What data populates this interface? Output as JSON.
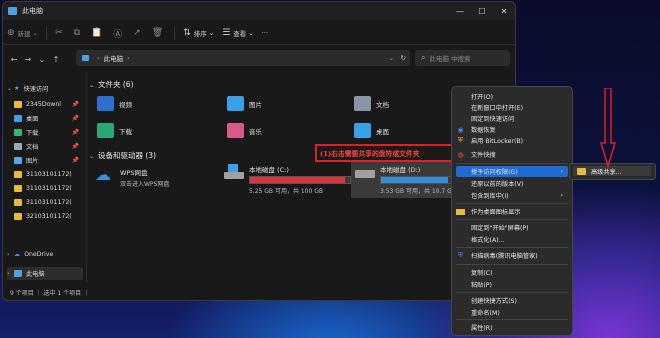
{
  "window": {
    "title": "此电脑",
    "controls": {
      "minimize": "—",
      "maximize": "☐",
      "close": "✕"
    }
  },
  "toolbar": {
    "new_label": "新建",
    "sort_label": "排序",
    "view_label": "查看",
    "more_label": "···"
  },
  "address": {
    "path": "此电脑",
    "search_placeholder": "此电脑 中搜索"
  },
  "sidebar": {
    "quick_access": "快速访问",
    "items": [
      {
        "label": "2345Downl"
      },
      {
        "label": "桌面"
      },
      {
        "label": "下载"
      },
      {
        "label": "文档"
      },
      {
        "label": "图片"
      },
      {
        "label": "31103101172("
      },
      {
        "label": "31103101172("
      },
      {
        "label": "31103101172("
      },
      {
        "label": "32103101172("
      }
    ],
    "onedrive": "OneDrive",
    "this_pc": "此电脑"
  },
  "main": {
    "folders_header": "文件夹 (6)",
    "folders": [
      "视频",
      "图片",
      "文档",
      "下载",
      "音乐",
      "桌面"
    ],
    "devices_header": "设备和驱动器 (3)",
    "drives": [
      {
        "name": "WPS网盘",
        "sub": "双击进入WPS网盘"
      },
      {
        "name": "本地磁盘 (C:)",
        "sub": "5.25 GB 可用，共 100 GB",
        "used": 0.95
      },
      {
        "name": "本地磁盘 (D:)",
        "sub": "3.53 GB 可用，共 10.7 GB",
        "used": 0.67
      }
    ]
  },
  "status": {
    "text": "9 个项目 ｜ 选中 1 个项目 ｜"
  },
  "annotation": {
    "text": "(1)右击需要共享的盘符或文件夹"
  },
  "context_menu": {
    "items": [
      "打开(O)",
      "在新窗口中打开(E)",
      "固定到快速访问",
      "数据恢复",
      "启用 BitLocker(B)",
      "文件快搜",
      "授予访问权限(G)",
      "还原以前的版本(V)",
      "包含到库中(I)",
      "作为桌面图标显示",
      "固定到\"开始\"屏幕(P)",
      "格式化(A)...",
      "扫描病毒(腾讯电脑管家)",
      "复制(C)",
      "粘贴(P)",
      "创建快捷方式(S)",
      "重命名(M)",
      "属性(R)"
    ],
    "submenu_item": "高级共享..."
  },
  "colors": {
    "accent": "#1f6bd0",
    "annotation": "#e02020",
    "drive_c_bar": "#d9363e",
    "drive_d_bar": "#2f8fdc"
  }
}
